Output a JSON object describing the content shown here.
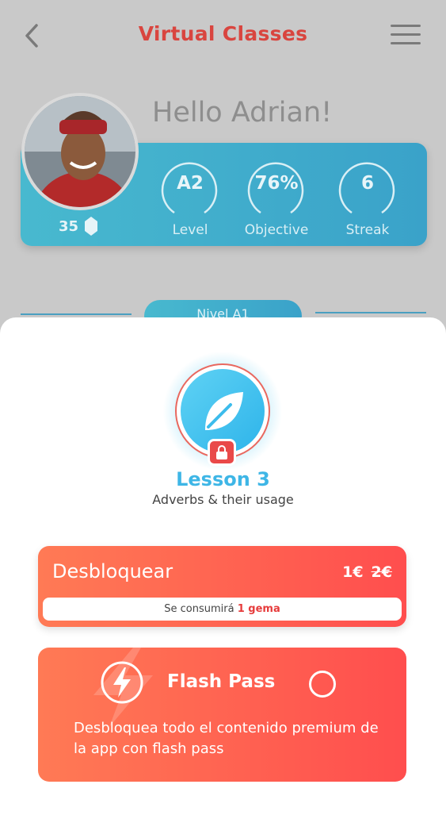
{
  "header": {
    "title": "Virtual Classes",
    "back_icon": "chevron-left-icon",
    "menu_icon": "hamburger-menu-icon"
  },
  "profile": {
    "greeting": "Hello Adrian!",
    "gems": "35",
    "gem_icon": "gem-icon"
  },
  "stats": [
    {
      "value": "A2",
      "label": "Level"
    },
    {
      "value": "76%",
      "label": "Objective"
    },
    {
      "value": "6",
      "label": "Streak"
    }
  ],
  "level_pill": "Nivel A1",
  "lesson": {
    "title": "Lesson 3",
    "subtitle": "Adverbs & their usage",
    "icon": "leaf-icon",
    "lock_icon": "lock-icon"
  },
  "unlock": {
    "label": "Desbloquear",
    "price": "1€",
    "old_price": "2€",
    "consume_prefix": "Se consumirá",
    "consume_amount": "1 gema"
  },
  "flash_pass": {
    "title": "Flash Pass",
    "icon": "lightning-icon",
    "description": "Desbloquea todo el contenido premium de la app con flash pass"
  },
  "colors": {
    "accent_red": "#d9453f",
    "teal": "#3aa2c9",
    "lesson_blue": "#3eb6e6",
    "orange_gradient_start": "#ff7a55",
    "orange_gradient_end": "#ff4e4e"
  }
}
